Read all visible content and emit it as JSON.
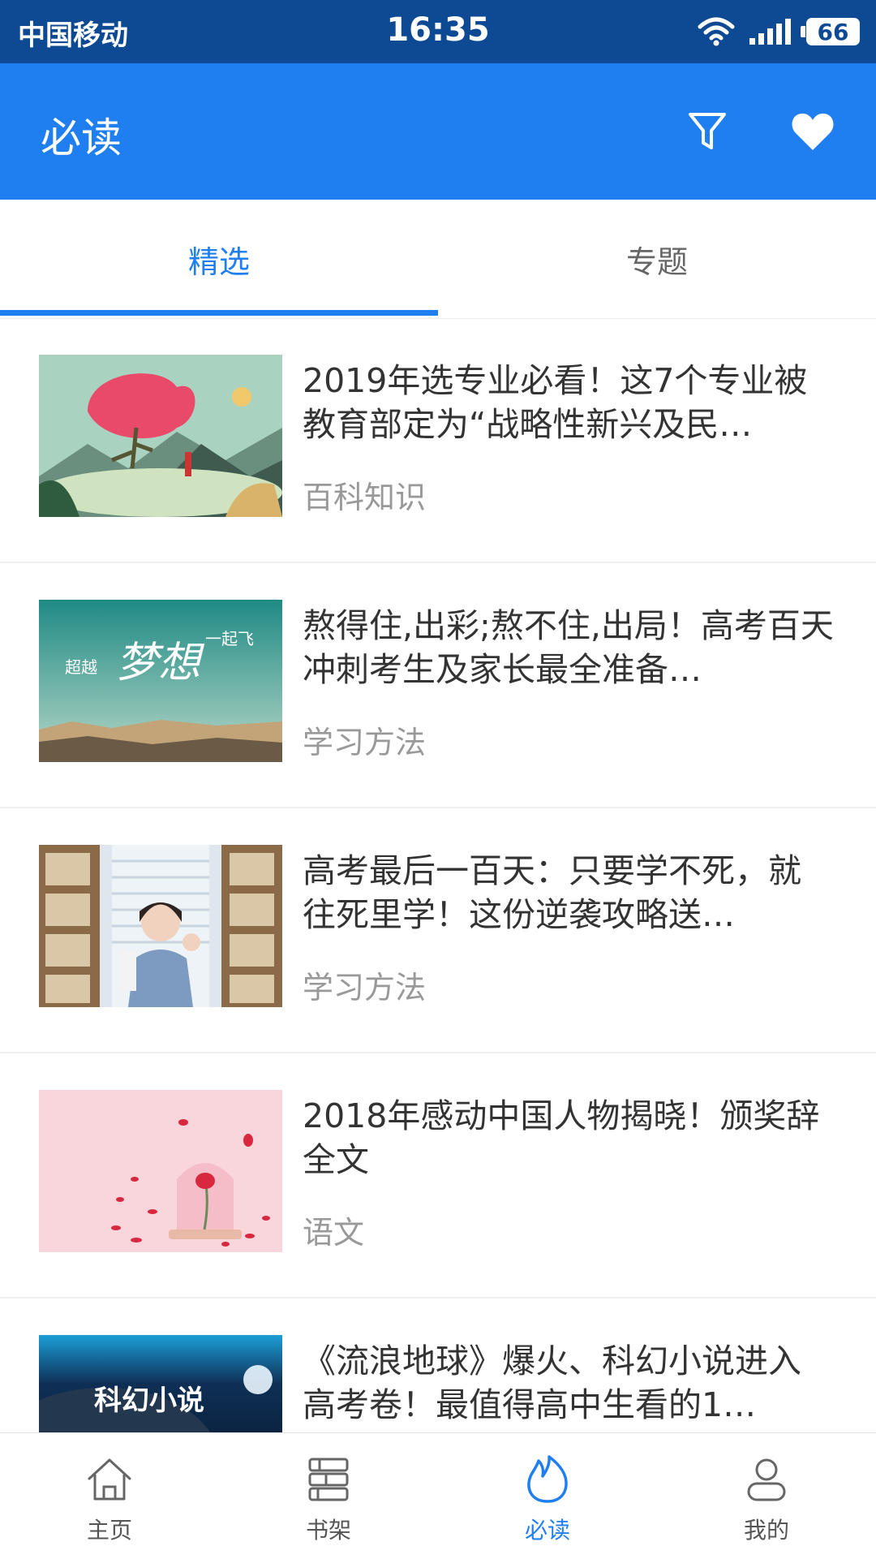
{
  "status": {
    "carrier": "中国移动",
    "time": "16:35",
    "battery": "66"
  },
  "header": {
    "title": "必读"
  },
  "tabs": [
    {
      "label": "精选",
      "active": true
    },
    {
      "label": "专题",
      "active": false
    }
  ],
  "articles": [
    {
      "title": "2019年选专业必看！这7个专业被教育部定为“战略性新兴及民…",
      "category": "百科知识"
    },
    {
      "title": "熬得住,出彩;熬不住,出局！高考百天冲刺考生及家长最全准备…",
      "category": "学习方法"
    },
    {
      "title": "高考最后一百天：只要学不死，就往死里学！这份逆袭攻略送…",
      "category": "学习方法"
    },
    {
      "title": "2018年感动中国人物揭晓！颁奖辞全文",
      "category": "语文"
    },
    {
      "title": "《流浪地球》爆火、科幻小说进入高考卷！最值得高中生看的1…",
      "category": ""
    }
  ],
  "thumb_text": {
    "t2_a": "超越",
    "t2_b": "梦想",
    "t2_c": "一起飞",
    "t5": "科幻小说"
  },
  "nav": [
    {
      "label": "主页",
      "icon": "home-icon"
    },
    {
      "label": "书架",
      "icon": "bookshelf-icon"
    },
    {
      "label": "必读",
      "icon": "flame-icon",
      "active": true
    },
    {
      "label": "我的",
      "icon": "person-icon"
    }
  ],
  "colors": {
    "primary": "#1f7ff0",
    "statusbar": "#0d4a93"
  }
}
